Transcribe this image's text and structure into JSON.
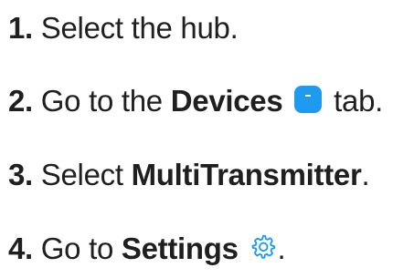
{
  "steps": [
    {
      "number": "1.",
      "prefix": "Select the hub.",
      "bold": "",
      "suffix": ""
    },
    {
      "number": "2.",
      "prefix": "Go to the ",
      "bold": "Devices",
      "icon": "devices-tab-icon",
      "suffix": " tab."
    },
    {
      "number": "3.",
      "prefix": "Select ",
      "bold": "MultiTransmitter",
      "suffix": "."
    },
    {
      "number": "4.",
      "prefix": "Go to ",
      "bold": "Settings",
      "icon": "gear-icon",
      "suffix": "."
    }
  ],
  "colors": {
    "text": "#1f1f1f",
    "accent": "#1e9bf0"
  }
}
